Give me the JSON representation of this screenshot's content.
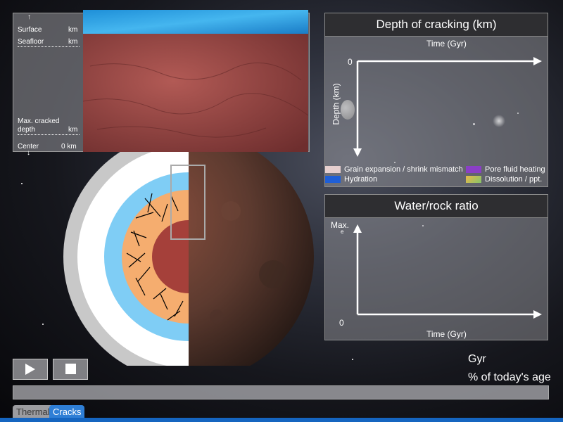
{
  "zoom_panel": {
    "surface_label": "Surface",
    "seafloor_label": "Seafloor",
    "max_cracked_label_line1": "Max. cracked",
    "max_cracked_label_line2": "depth",
    "center_label": "Center",
    "surface_unit": "km",
    "seafloor_unit": "km",
    "max_cracked_unit": "km",
    "center_value": "0 km",
    "arrow_up": "↑",
    "arrow_down": "↓"
  },
  "depth_chart": {
    "title": "Depth of cracking (km)",
    "x_label": "Time (Gyr)",
    "y_label": "Depth (km)",
    "y_zero": "0",
    "legend": [
      {
        "label": "Grain expansion / shrink mismatch",
        "color": "#e6cfcf"
      },
      {
        "label": "Pore fluid heating",
        "color": "#8a3fc6"
      },
      {
        "label": "Hydration",
        "color": "#1f5fd6"
      },
      {
        "label": "Dissolution / ppt.",
        "color": "#b4c56a"
      }
    ]
  },
  "water_chart": {
    "title": "Water/rock ratio",
    "y_max_label": "Max.",
    "y_max_sub": "e",
    "y_zero": "0",
    "x_label": "Time (Gyr)"
  },
  "controls": {
    "play_label": "play",
    "stop_label": "stop",
    "time_unit": "Gyr",
    "pct_label": "% of today's age",
    "progress": 0
  },
  "tabs": [
    {
      "label": "Thermal",
      "active": false
    },
    {
      "label": "Cracks",
      "active": true
    }
  ],
  "colors": {
    "ocean": "#7fcdf5",
    "mantle": "#f5ad6f",
    "core": "#a5403a",
    "crust_light": "#c8c8c8",
    "tab_active": "#2f7fd6"
  }
}
